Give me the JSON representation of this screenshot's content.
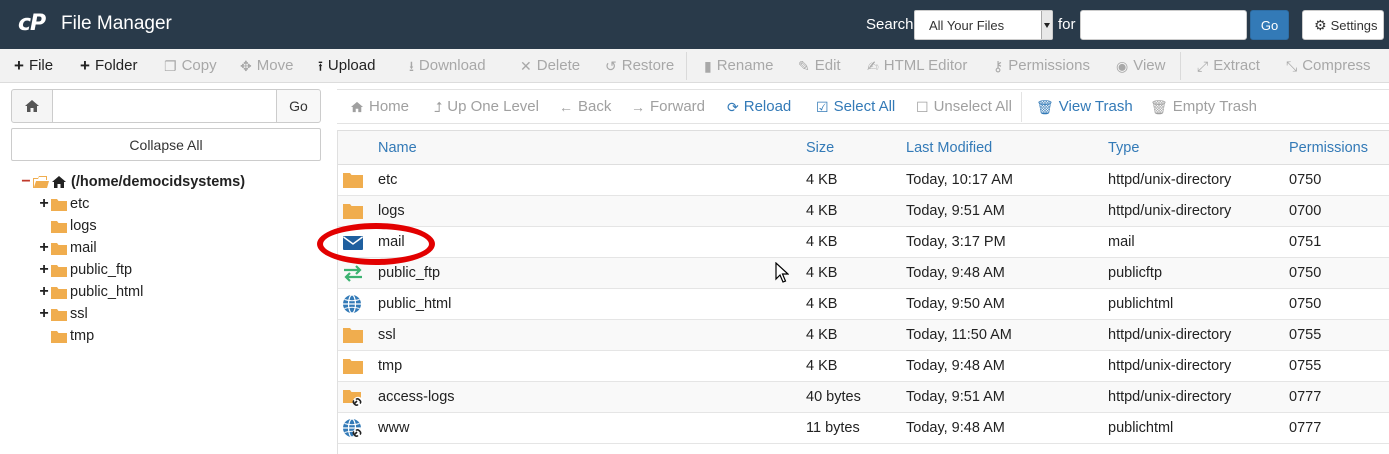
{
  "header": {
    "logo": "cP",
    "title": "File Manager",
    "search_label": "Search",
    "search_scope": "All Your Files",
    "for_label": "for",
    "search_value": "",
    "go_label": "Go",
    "settings_label": "Settings"
  },
  "toolbar": {
    "file": "File",
    "folder": "Folder",
    "copy": "Copy",
    "move": "Move",
    "upload": "Upload",
    "download": "Download",
    "delete": "Delete",
    "restore": "Restore",
    "rename": "Rename",
    "edit": "Edit",
    "html_editor": "HTML Editor",
    "permissions": "Permissions",
    "view": "View",
    "extract": "Extract",
    "compress": "Compress"
  },
  "left": {
    "path_value": "",
    "go_label": "Go",
    "collapse_label": "Collapse All",
    "root_label": "(/home/democidsystems)",
    "tree": [
      {
        "label": "etc",
        "expandable": true
      },
      {
        "label": "logs",
        "expandable": false
      },
      {
        "label": "mail",
        "expandable": true
      },
      {
        "label": "public_ftp",
        "expandable": true
      },
      {
        "label": "public_html",
        "expandable": true
      },
      {
        "label": "ssl",
        "expandable": true
      },
      {
        "label": "tmp",
        "expandable": false
      }
    ]
  },
  "nav": {
    "home": "Home",
    "up_one_level": "Up One Level",
    "back": "Back",
    "forward": "Forward",
    "reload": "Reload",
    "select_all": "Select All",
    "unselect_all": "Unselect All",
    "view_trash": "View Trash",
    "empty_trash": "Empty Trash"
  },
  "table": {
    "columns": {
      "name": "Name",
      "size": "Size",
      "modified": "Last Modified",
      "type": "Type",
      "permissions": "Permissions"
    },
    "rows": [
      {
        "icon": "folder",
        "name": "etc",
        "size": "4 KB",
        "modified": "Today, 10:17 AM",
        "type": "httpd/unix-directory",
        "perms": "0750"
      },
      {
        "icon": "folder",
        "name": "logs",
        "size": "4 KB",
        "modified": "Today, 9:51 AM",
        "type": "httpd/unix-directory",
        "perms": "0700"
      },
      {
        "icon": "mail",
        "name": "mail",
        "size": "4 KB",
        "modified": "Today, 3:17 PM",
        "type": "mail",
        "perms": "0751"
      },
      {
        "icon": "ftp",
        "name": "public_ftp",
        "size": "4 KB",
        "modified": "Today, 9:48 AM",
        "type": "publicftp",
        "perms": "0750"
      },
      {
        "icon": "globe",
        "name": "public_html",
        "size": "4 KB",
        "modified": "Today, 9:50 AM",
        "type": "publichtml",
        "perms": "0750"
      },
      {
        "icon": "folder",
        "name": "ssl",
        "size": "4 KB",
        "modified": "Today, 11:50 AM",
        "type": "httpd/unix-directory",
        "perms": "0755"
      },
      {
        "icon": "folder",
        "name": "tmp",
        "size": "4 KB",
        "modified": "Today, 9:48 AM",
        "type": "httpd/unix-directory",
        "perms": "0755"
      },
      {
        "icon": "folder-link",
        "name": "access-logs",
        "size": "40 bytes",
        "modified": "Today, 9:51 AM",
        "type": "httpd/unix-directory",
        "perms": "0777"
      },
      {
        "icon": "globe-link",
        "name": "www",
        "size": "11 bytes",
        "modified": "Today, 9:48 AM",
        "type": "publichtml",
        "perms": "0777"
      }
    ]
  },
  "colors": {
    "header_bg": "#293a4a",
    "accent": "#337ab7",
    "folder": "#f0ad4e",
    "annotation": "#e20000"
  }
}
